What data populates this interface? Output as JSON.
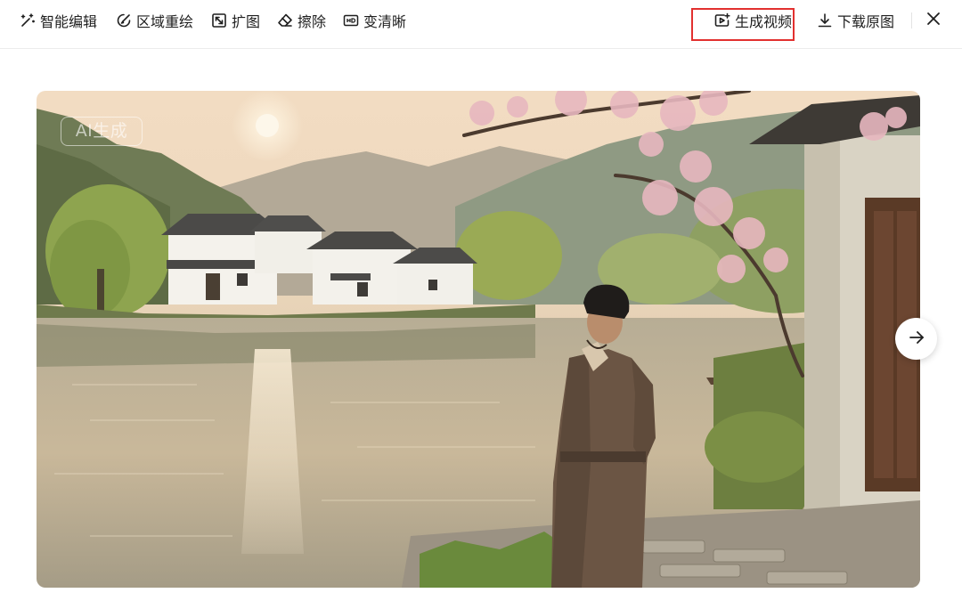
{
  "toolbar": {
    "smart_edit_label": "智能编辑",
    "region_redraw_label": "区域重绘",
    "expand_label": "扩图",
    "erase_label": "擦除",
    "sharpen_label": "变清晰",
    "generate_video_label": "生成视频",
    "download_original_label": "下载原图",
    "highlight_color": "#e2302f"
  },
  "icons": {
    "smart_edit": "magic-wand-icon",
    "region_redraw": "brush-icon",
    "expand": "expand-icon",
    "erase": "eraser-icon",
    "sharpen": "hd-icon",
    "generate_video": "video-add-icon",
    "download": "download-icon",
    "close": "close-icon",
    "next": "arrow-right-icon"
  },
  "image": {
    "badge": "AI生成",
    "scene": "riverside-village-with-blossoms-and-robed-man"
  }
}
